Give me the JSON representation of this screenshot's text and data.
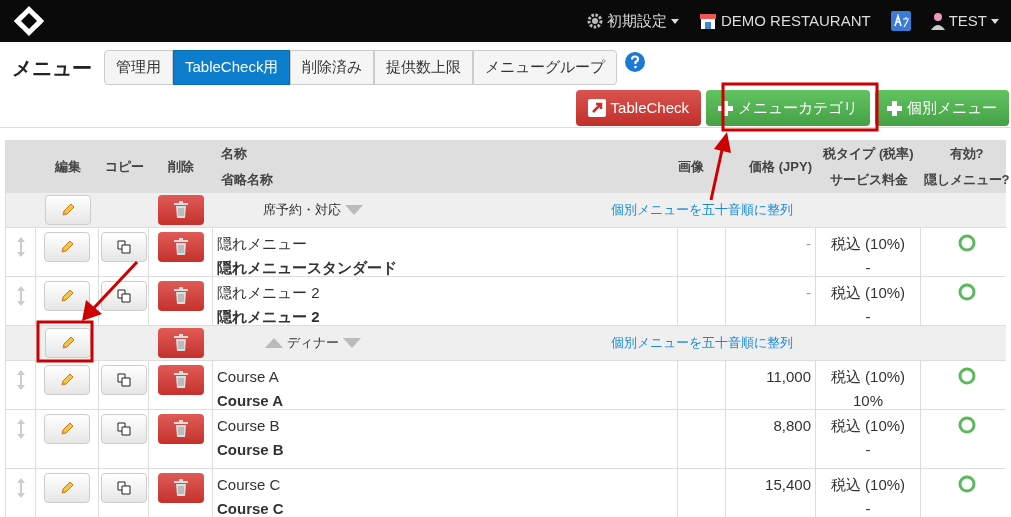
{
  "navbar": {
    "settings": "初期設定",
    "restaurant": "DEMO RESTAURANT",
    "user": "TEST"
  },
  "page_title": "メニュー",
  "tabs": [
    {
      "label": "管理用",
      "selected": false
    },
    {
      "label": "TableCheck用",
      "selected": true
    },
    {
      "label": "削除済み",
      "selected": false
    },
    {
      "label": "提供数上限",
      "selected": false
    },
    {
      "label": "メニューグループ",
      "selected": false
    }
  ],
  "actions": [
    {
      "kind": "external",
      "label": "TableCheck"
    },
    {
      "kind": "add",
      "label": "メニューカテゴリ"
    },
    {
      "kind": "add",
      "label": "個別メニュー"
    }
  ],
  "table": {
    "columns": [
      {
        "lines": [
          "編集"
        ]
      },
      {
        "lines": [
          "コピー"
        ]
      },
      {
        "lines": [
          "削除"
        ]
      },
      {
        "lines": [
          "名称",
          "省略名称"
        ]
      },
      {
        "lines": [
          "画像"
        ]
      },
      {
        "lines": [
          "価格 (JPY)"
        ]
      },
      {
        "lines": [
          "税タイプ (税率)",
          "サービス料金"
        ]
      },
      {
        "lines": [
          "有効?",
          "隠しメニュー?"
        ]
      }
    ],
    "rows": [
      {
        "kind": "category",
        "name": "席予約・対応",
        "can_move_up": false,
        "can_move_down": true,
        "sort_link": "個別メニューを五十音順に整列"
      },
      {
        "kind": "item",
        "name": "隠れメニュー",
        "short_name": "隠れメニュースタンダード",
        "price": "-",
        "tax": "税込 (10%)",
        "service": "-",
        "valid": true
      },
      {
        "kind": "item",
        "name": "隠れメニュー 2",
        "short_name": "隠れメニュー 2",
        "price": "-",
        "tax": "税込 (10%)",
        "service": "-",
        "valid": true
      },
      {
        "kind": "category",
        "name": "ディナー",
        "can_move_up": true,
        "can_move_down": true,
        "sort_link": "個別メニューを五十音順に整列"
      },
      {
        "kind": "item",
        "name": "Course A",
        "short_name": "Course A",
        "price": "11,000",
        "tax": "税込 (10%)",
        "service": "10%",
        "valid": true
      },
      {
        "kind": "item",
        "name": "Course B",
        "short_name": "Course B",
        "price": "8,800",
        "tax": "税込 (10%)",
        "service": "-",
        "valid": true
      },
      {
        "kind": "item",
        "name": "Course C",
        "short_name": "Course C",
        "price": "15,400",
        "tax": "税込 (10%)",
        "service": "-",
        "valid": true
      }
    ]
  }
}
